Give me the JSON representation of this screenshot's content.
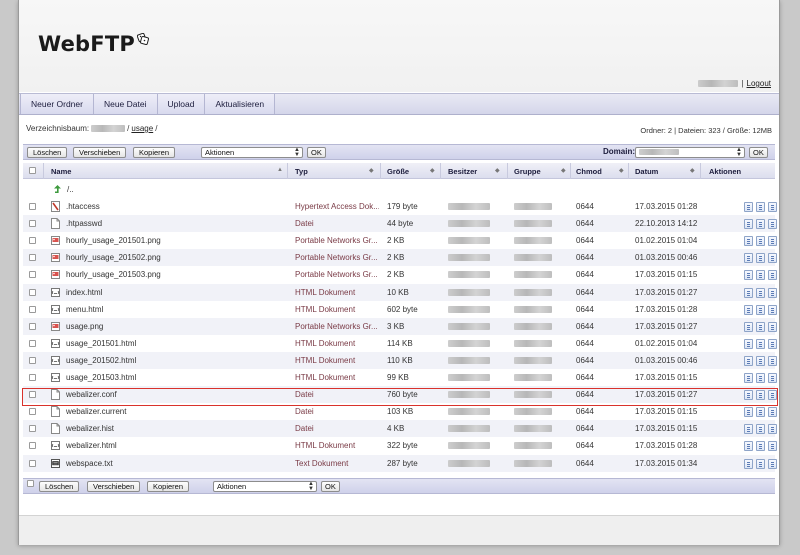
{
  "app": {
    "logo": "WebFTP",
    "logout_label": "Logout",
    "user_separator": "|"
  },
  "toolbar": {
    "new_folder": "Neuer Ordner",
    "new_file": "Neue Datei",
    "upload": "Upload",
    "refresh": "Aktualisieren"
  },
  "path": {
    "label": "Verzeichnisbaum:",
    "sep": "/",
    "current": "usage",
    "trail": "/"
  },
  "stats": "Ordner: 2 | Dateien: 323 / Größe: 12MB",
  "actions": {
    "delete": "Löschen",
    "move": "Verschieben",
    "copy": "Kopieren",
    "select_value": "Aktionen",
    "ok": "OK",
    "domain_label": "Domain:"
  },
  "columns": {
    "name": "Name",
    "type": "Typ",
    "size": "Größe",
    "owner": "Besitzer",
    "group": "Gruppe",
    "chmod": "Chmod",
    "date": "Datum",
    "actions": "Aktionen"
  },
  "parent_dir": "/..",
  "rows": [
    {
      "name": ".htaccess",
      "type": "Hypertext Access Dok...",
      "size": "179 byte",
      "chmod": "0644",
      "date": "17.03.2015 01:28",
      "icon": "htaccess-icon"
    },
    {
      "name": ".htpasswd",
      "type": "Datei",
      "size": "44 byte",
      "chmod": "0644",
      "date": "22.10.2013 14:12",
      "icon": "file-icon"
    },
    {
      "name": "hourly_usage_201501.png",
      "type": "Portable Networks Gr...",
      "size": "2 KB",
      "chmod": "0644",
      "date": "01.02.2015 01:04",
      "icon": "image-icon"
    },
    {
      "name": "hourly_usage_201502.png",
      "type": "Portable Networks Gr...",
      "size": "2 KB",
      "chmod": "0644",
      "date": "01.03.2015 00:46",
      "icon": "image-icon"
    },
    {
      "name": "hourly_usage_201503.png",
      "type": "Portable Networks Gr...",
      "size": "2 KB",
      "chmod": "0644",
      "date": "17.03.2015 01:15",
      "icon": "image-icon"
    },
    {
      "name": "index.html",
      "type": "HTML Dokument",
      "size": "10 KB",
      "chmod": "0644",
      "date": "17.03.2015 01:27",
      "icon": "html-icon"
    },
    {
      "name": "menu.html",
      "type": "HTML Dokument",
      "size": "602 byte",
      "chmod": "0644",
      "date": "17.03.2015 01:28",
      "icon": "html-icon"
    },
    {
      "name": "usage.png",
      "type": "Portable Networks Gr...",
      "size": "3 KB",
      "chmod": "0644",
      "date": "17.03.2015 01:27",
      "icon": "image-icon"
    },
    {
      "name": "usage_201501.html",
      "type": "HTML Dokument",
      "size": "114 KB",
      "chmod": "0644",
      "date": "01.02.2015 01:04",
      "icon": "html-icon"
    },
    {
      "name": "usage_201502.html",
      "type": "HTML Dokument",
      "size": "110 KB",
      "chmod": "0644",
      "date": "01.03.2015 00:46",
      "icon": "html-icon"
    },
    {
      "name": "usage_201503.html",
      "type": "HTML Dokument",
      "size": "99 KB",
      "chmod": "0644",
      "date": "17.03.2015 01:15",
      "icon": "html-icon"
    },
    {
      "name": "webalizer.conf",
      "type": "Datei",
      "size": "760 byte",
      "chmod": "0644",
      "date": "17.03.2015 01:27",
      "icon": "file-icon"
    },
    {
      "name": "webalizer.current",
      "type": "Datei",
      "size": "103 KB",
      "chmod": "0644",
      "date": "17.03.2015 01:15",
      "icon": "file-icon"
    },
    {
      "name": "webalizer.hist",
      "type": "Datei",
      "size": "4 KB",
      "chmod": "0644",
      "date": "17.03.2015 01:15",
      "icon": "file-icon"
    },
    {
      "name": "webalizer.html",
      "type": "HTML Dokument",
      "size": "322 byte",
      "chmod": "0644",
      "date": "17.03.2015 01:28",
      "icon": "html-icon"
    },
    {
      "name": "webspace.txt",
      "type": "Text Dokument",
      "size": "287 byte",
      "chmod": "0644",
      "date": "17.03.2015 01:34",
      "icon": "text-icon"
    }
  ],
  "colors": {
    "accent_border": "#d9322c",
    "toolbar_bg": "#d4d6ea",
    "type_text": "#7a3b46"
  }
}
